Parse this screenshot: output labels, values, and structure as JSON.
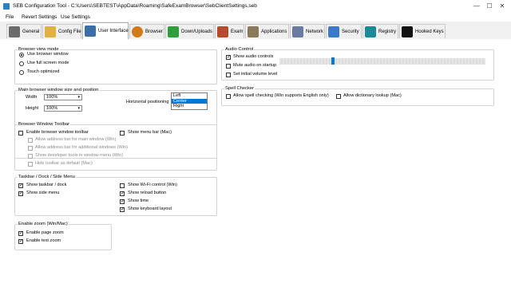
{
  "window": {
    "title": "SEB Configuration Tool - C:\\Users\\SEBTEST\\AppData\\Roaming\\SafeExamBrowser\\SebClientSettings.seb",
    "minimize": "—",
    "maximize": "☐",
    "close": "✕"
  },
  "menu": {
    "file": "File",
    "revert": "Revert Settings",
    "use": "Use Settings"
  },
  "tabs": [
    {
      "label": "General",
      "icon": "general-icon",
      "color": "#6b6b6b"
    },
    {
      "label": "Config File",
      "icon": "config-file-icon",
      "color": "#e0b040"
    },
    {
      "label": "User Interface",
      "icon": "user-interface-icon",
      "color": "#3a6ea5"
    },
    {
      "label": "Browser",
      "icon": "browser-globe-icon",
      "color": "#d27a1a"
    },
    {
      "label": "Down/Uploads",
      "icon": "down-uploads-icon",
      "color": "#2e9e3a"
    },
    {
      "label": "Exam",
      "icon": "exam-icon",
      "color": "#b54a2c"
    },
    {
      "label": "Applications",
      "icon": "applications-icon",
      "color": "#8a7a5a"
    },
    {
      "label": "Network",
      "icon": "network-icon",
      "color": "#6a7aa0"
    },
    {
      "label": "Security",
      "icon": "security-icon",
      "color": "#3a7ac8"
    },
    {
      "label": "Registry",
      "icon": "registry-icon",
      "color": "#1a8a9a"
    },
    {
      "label": "Hooked Keys",
      "icon": "hooked-keys-icon",
      "color": "#111111"
    }
  ],
  "view_mode": {
    "title": "Browser view mode",
    "options": [
      "Use browser window",
      "Use full screen mode",
      "Touch optimized"
    ],
    "selected": "Use browser window"
  },
  "window_size": {
    "title": "Main browser window size and position",
    "width_label": "Width",
    "width_value": "100%",
    "height_label": "Height",
    "height_value": "100%",
    "hpos_label": "Horizontal positioning",
    "hpos_options": [
      "Left",
      "Center",
      "Right"
    ],
    "hpos_selected": "Center"
  },
  "toolbar": {
    "title": "Browser Window Toolbar",
    "enable": "Enable browser window toolbar",
    "addr_main": "Allow address bar for main window (Win)",
    "addr_additional": "Allow address bar for additional windows (Win)",
    "dev_tools": "Show developer tools in window menu (Win)",
    "hide_default": "Hide toolbar as default (Mac)",
    "menu_bar": "Show menu bar (Mac)"
  },
  "taskbar": {
    "title": "Taskbar / Dock / Side Menu",
    "taskbar": "Show taskbar / dock",
    "side_menu": "Show side menu",
    "wifi": "Show Wi-Fi control (Win)",
    "reload": "Show reload button",
    "time": "Show time",
    "keyboard": "Show keyboard layout"
  },
  "zoom": {
    "title": "Enable zoom (Win/Mac)",
    "page": "Enable page zoom",
    "text": "Enable text zoom"
  },
  "audio": {
    "title": "Audio Control",
    "show": "Show audio controls",
    "mute": "Mute audio on startup",
    "initial": "Set initial volume level",
    "volume_fraction": 0.25
  },
  "spell": {
    "title": "Spell Checker",
    "allow": "Allow spell checking (Win supports English only)",
    "dictionary": "Allow dictionary lookup (Mac)"
  },
  "check": "✓"
}
